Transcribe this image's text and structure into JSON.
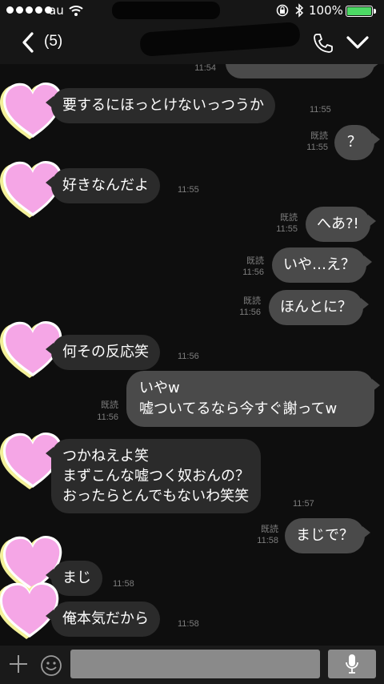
{
  "status_bar": {
    "carrier": "au",
    "battery": "100%"
  },
  "header": {
    "unread_count": "(5)"
  },
  "messages": {
    "m0": {
      "time": "11:54"
    },
    "m1": {
      "text": "要するにほっとけないっつうか",
      "time": "11:55"
    },
    "m2": {
      "text": "？",
      "read": "既読",
      "time": "11:55"
    },
    "m3": {
      "text": "好きなんだよ",
      "time": "11:55"
    },
    "m4": {
      "text": "へあ?!",
      "read": "既読",
      "time": "11:55"
    },
    "m5": {
      "text": "いや…え？",
      "read": "既読",
      "time": "11:56"
    },
    "m6": {
      "text": "ほんとに？",
      "read": "既読",
      "time": "11:56"
    },
    "m7": {
      "text": "何その反応笑",
      "time": "11:56"
    },
    "m8": {
      "text": "いやw\n嘘ついてるなら今すぐ謝ってw",
      "read": "既読",
      "time": "11:56"
    },
    "m9": {
      "text": "つかねえよ笑\nまずこんな嘘つく奴おんの？\nおったらとんでもないわ笑笑",
      "time": "11:57"
    },
    "m10": {
      "text": "まじで？",
      "read": "既読",
      "time": "11:58"
    },
    "m11": {
      "text": "まじ",
      "time": "11:58"
    },
    "m12": {
      "text": "俺本気だから",
      "time": "11:58"
    }
  },
  "input": {
    "placeholder": ""
  },
  "colors": {
    "incoming_bubble": "#2b2b2b",
    "outgoing_bubble": "#4a4a4a",
    "avatar_pink": "#f5a6e6",
    "battery_green": "#4cd964"
  },
  "icons": [
    "back-arrow-icon",
    "phone-icon",
    "chevron-down-icon",
    "plus-icon",
    "emoji-icon",
    "mic-icon",
    "wifi-icon",
    "bluetooth-icon",
    "rotation-lock-icon",
    "heart-avatar-icon"
  ]
}
